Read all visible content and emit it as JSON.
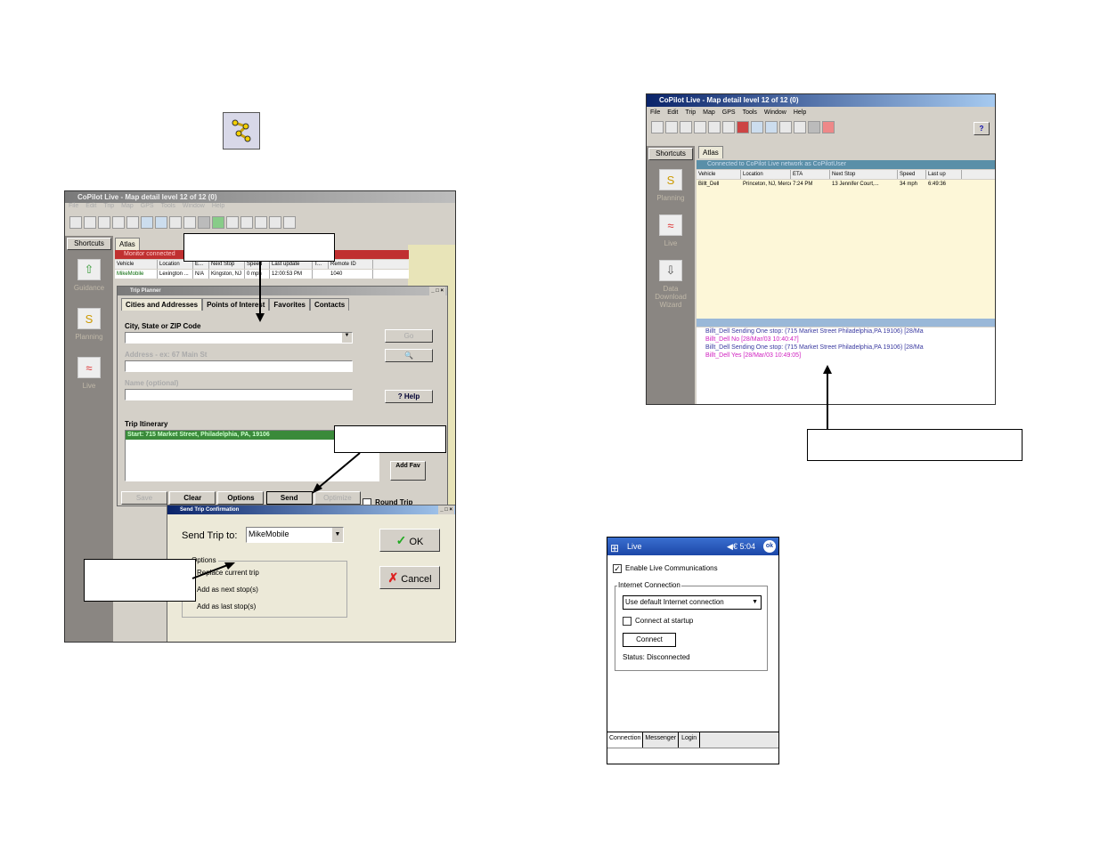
{
  "left_window": {
    "title": "CoPilot Live - Map detail level 12 of 12 (0)",
    "menu": [
      "File",
      "Edit",
      "Trip",
      "Map",
      "GPS",
      "Tools",
      "Window",
      "Help"
    ],
    "shortcuts_label": "Shortcuts",
    "atlas_tab": "Atlas",
    "monitor_bar": "Monitor connected",
    "columns": [
      "Vehicle",
      "Location",
      "E...",
      "Next Stop",
      "Speed",
      "Last update",
      "T...",
      "Remote ID"
    ],
    "row": [
      "MikeMobile",
      "Lexington ...",
      "N/A",
      "Kingston, NJ",
      "0 mph",
      "12:00:53 PM",
      "",
      "1040"
    ],
    "sidebar": [
      "Guidance",
      "Planning",
      "Live"
    ]
  },
  "trip_planner": {
    "title": "Trip Planner",
    "tabs": [
      "Cities and Addresses",
      "Points of Interest",
      "Favorites",
      "Contacts"
    ],
    "city_label": "City, State or ZIP Code",
    "address_label": "Address - ex: 67 Main St",
    "name_label": "Name (optional)",
    "go_label": "Go",
    "help_label": "? Help",
    "itinerary_label": "Trip Itinerary",
    "itinerary_start": "Start: 715 Market Street, Philadelphia, PA, 19106",
    "add_fav": "Add Fav",
    "buttons": [
      "Save",
      "Clear",
      "Options",
      "Send",
      "Optimize"
    ],
    "round_trip": "Round Trip"
  },
  "send_confirmation": {
    "title": "Send Trip Confirmation",
    "send_to_label": "Send Trip to:",
    "send_to_value": "MikeMobile",
    "ok_label": "OK",
    "cancel_label": "Cancel",
    "options_label": "Options",
    "options": [
      "Replace current trip",
      "Add as next stop(s)",
      "Add as last stop(s)"
    ]
  },
  "right_window": {
    "title": "CoPilot Live - Map detail level 12 of 12 (0)",
    "menu": [
      "File",
      "Edit",
      "Trip",
      "Map",
      "GPS",
      "Tools",
      "Window",
      "Help"
    ],
    "shortcuts_label": "Shortcuts",
    "atlas_tab": "Atlas",
    "connected_bar": "Connected to CoPilot Live network as CoPilotUser",
    "columns": [
      "Vehicle",
      "Location",
      "ETA",
      "Next Stop",
      "Speed",
      "Last up"
    ],
    "row": [
      "Billt_Dell",
      "Princeton, NJ, Mercer",
      "7:24 PM",
      "13 Jennifer Court,...",
      "34 mph",
      "6:49:36"
    ],
    "sidebar": [
      "Planning",
      "Live",
      "Data Download Wizard"
    ],
    "messages": [
      {
        "text": "Billt_Dell   Sending One stop: (715 Market Street Philadelphia,PA 19106)   [28/Ma",
        "color": "#3a3aa0"
      },
      {
        "text": "Billt_Dell   No     [28/Mar/03 10:40:47]",
        "color": "#d020c0"
      },
      {
        "text": "Billt_Dell   Sending One stop: (715 Market Street Philadelphia,PA 19106)   [28/Ma",
        "color": "#3a3aa0"
      },
      {
        "text": "Billt_Dell   Yes    [28/Mar/03 10:49:05]",
        "color": "#d020c0"
      }
    ]
  },
  "pocket_pc": {
    "title": "Live",
    "status": "◀€ 5:04",
    "ok": "ok",
    "enable_label": "Enable Live Communications",
    "group_label": "Internet Connection",
    "dropdown_value": "Use default Internet connection",
    "connect_startup": "Connect at startup",
    "connect_button": "Connect",
    "status_text": "Status: Disconnected",
    "tabs": [
      "Connection",
      "Messenger",
      "Login"
    ]
  }
}
